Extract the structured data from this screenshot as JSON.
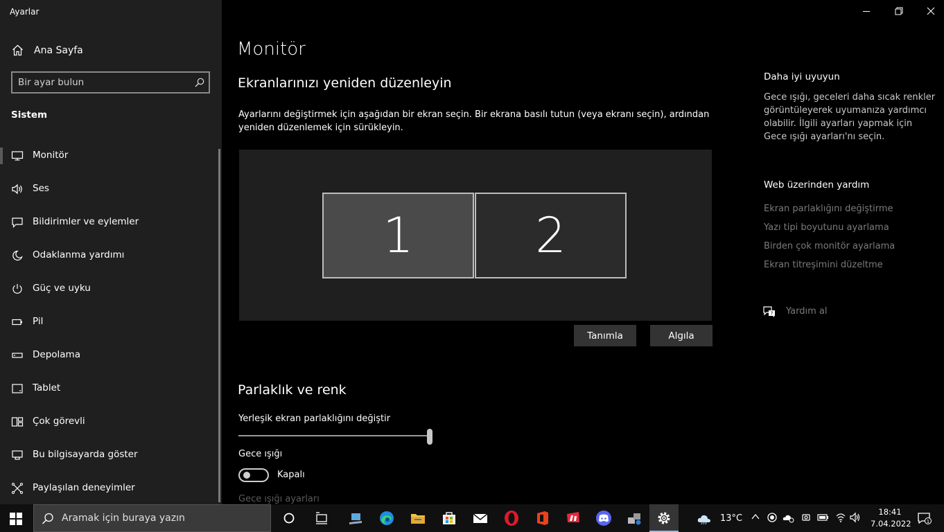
{
  "window": {
    "title": "Ayarlar"
  },
  "sidebar": {
    "home_label": "Ana Sayfa",
    "search_placeholder": "Bir ayar bulun",
    "section_label": "Sistem",
    "items": [
      {
        "label": "Monitör",
        "icon": "monitor-icon"
      },
      {
        "label": "Ses",
        "icon": "speaker-icon"
      },
      {
        "label": "Bildirimler ve eylemler",
        "icon": "notification-icon"
      },
      {
        "label": "Odaklanma yardımı",
        "icon": "moon-icon"
      },
      {
        "label": "Güç ve uyku",
        "icon": "power-icon"
      },
      {
        "label": "Pil",
        "icon": "battery-icon"
      },
      {
        "label": "Depolama",
        "icon": "storage-icon"
      },
      {
        "label": "Tablet",
        "icon": "tablet-icon"
      },
      {
        "label": "Çok görevli",
        "icon": "multitask-icon"
      },
      {
        "label": "Bu bilgisayarda göster",
        "icon": "project-icon"
      },
      {
        "label": "Paylaşılan deneyimler",
        "icon": "shared-icon"
      }
    ]
  },
  "main": {
    "title": "Monitör",
    "arrange_heading": "Ekranlarınızı yeniden düzenleyin",
    "arrange_desc": "Ayarlarını değiştirmek için aşağıdan bir ekran seçin. Bir ekrana basılı tutun (veya ekranı seçin), ardından yeniden düzenlemek için sürükleyin.",
    "monitors": [
      "1",
      "2"
    ],
    "identify_button": "Tanımla",
    "detect_button": "Algıla",
    "brightness_heading": "Parlaklık ve renk",
    "brightness_label": "Yerleşik ekran parlaklığını değiştir",
    "brightness_value": 100,
    "night_light_label": "Gece ışığı",
    "night_light_state": "Kapalı",
    "night_light_settings": "Gece ışığı ayarları"
  },
  "right_panel": {
    "sleep_heading": "Daha iyi uyuyun",
    "sleep_text": "Gece ışığı, geceleri daha sıcak renkler görüntüleyerek uyumanıza yardımcı olabilir. İlgili ayarları yapmak için Gece ışığı ayarları'nı seçin.",
    "web_help_heading": "Web üzerinden yardım",
    "links": [
      "Ekran parlaklığını değiştirme",
      "Yazı tipi boyutunu ayarlama",
      "Birden çok monitör ayarlama",
      "Ekran titreşimini düzeltme"
    ],
    "get_help": "Yardım al"
  },
  "taskbar": {
    "search_placeholder": "Aramak için buraya yazın",
    "weather": "13°C",
    "time": "18:41",
    "date": "7.04.2022",
    "notifications": "1"
  }
}
